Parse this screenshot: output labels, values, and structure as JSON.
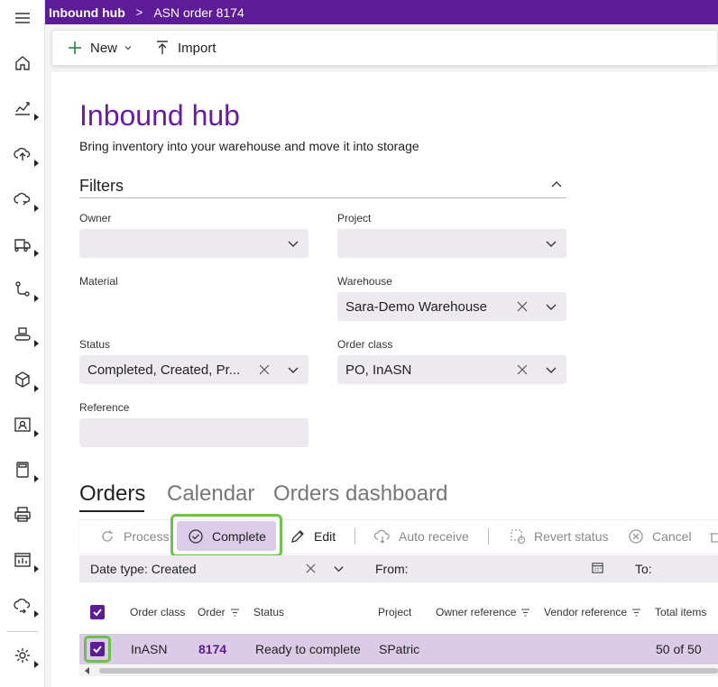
{
  "header": {
    "app_name": "Inbound hub",
    "separator": ">",
    "breadcrumb": "ASN order 8174"
  },
  "actionbar": {
    "new_label": "New",
    "import_label": "Import"
  },
  "page": {
    "title": "Inbound hub",
    "subtitle": "Bring inventory into your warehouse and move it into storage"
  },
  "filters": {
    "title": "Filters",
    "owner_label": "Owner",
    "owner_value": "",
    "project_label": "Project",
    "project_value": "",
    "material_label": "Material",
    "warehouse_label": "Warehouse",
    "warehouse_value": "Sara-Demo Warehouse",
    "status_label": "Status",
    "status_value": "Completed, Created, Pr...",
    "order_class_label": "Order class",
    "order_class_value": "PO, InASN",
    "reference_label": "Reference",
    "reference_value": ""
  },
  "tabs": {
    "orders": "Orders",
    "calendar": "Calendar",
    "dashboard": "Orders dashboard"
  },
  "grid_toolbar": {
    "process": "Process",
    "complete": "Complete",
    "edit": "Edit",
    "auto_receive": "Auto receive",
    "revert_status": "Revert status",
    "cancel": "Cancel"
  },
  "datebar": {
    "date_type": "Date type: Created",
    "from": "From:",
    "to": "To:"
  },
  "table": {
    "columns": {
      "order_class": "Order class",
      "order": "Order",
      "status": "Status",
      "project": "Project",
      "owner_reference": "Owner reference",
      "vendor_reference": "Vendor reference",
      "total_items": "Total items"
    },
    "rows": [
      {
        "order_class": "InASN",
        "order": "8174",
        "status": "Ready to complete",
        "project": "SPatric",
        "total_items": "50 of 50"
      }
    ]
  },
  "colors": {
    "brand": "#5d1c97",
    "title": "#6a1ba3",
    "highlight": "#6cc24a",
    "selected_row": "#dbcbe6"
  }
}
